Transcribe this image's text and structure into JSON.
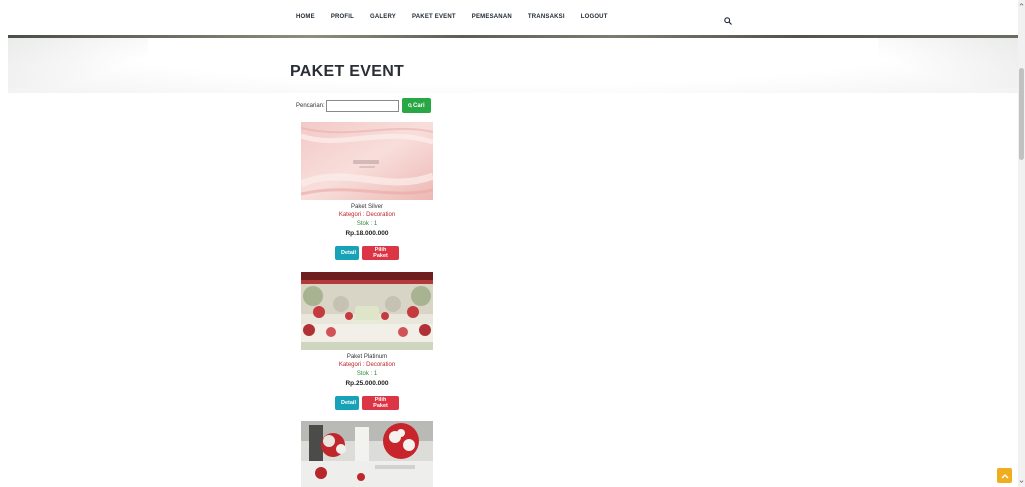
{
  "nav": {
    "items": [
      {
        "label": "HOME"
      },
      {
        "label": "PROFIL"
      },
      {
        "label": "GALERY"
      },
      {
        "label": "PAKET EVENT"
      },
      {
        "label": "PEMESANAN"
      },
      {
        "label": "TRANSAKSI"
      },
      {
        "label": "LOGOUT"
      }
    ],
    "search_icon": "search-icon"
  },
  "page": {
    "title": "PAKET EVENT"
  },
  "search": {
    "label": "Pencarian:",
    "value": "",
    "placeholder": "",
    "button_label": "Cari",
    "button_icon": "search-icon"
  },
  "products": [
    {
      "name": "Paket Silver",
      "kategori": "Kategori : Decoration",
      "stok": "Stok : 1",
      "price": "Rp.18.000.000",
      "detail_label": "Detail",
      "pilih_label": "Pilih Paket"
    },
    {
      "name": "Paket Platinum",
      "kategori": "Kategori : Decoration",
      "stok": "Stok : 1",
      "price": "Rp.25.000.000",
      "detail_label": "Detail",
      "pilih_label": "Pilih Paket"
    },
    {
      "name": "",
      "kategori": "",
      "stok": "",
      "price": "",
      "detail_label": "",
      "pilih_label": ""
    }
  ],
  "colors": {
    "search_button": "#28a745",
    "detail_button": "#17a2b8",
    "pilih_button": "#dc3545",
    "kategori_text": "#c0262b",
    "stok_text": "#2d8a3b",
    "back_to_top": "#f0ad1e"
  },
  "back_to_top_icon": "chevron-up-icon"
}
